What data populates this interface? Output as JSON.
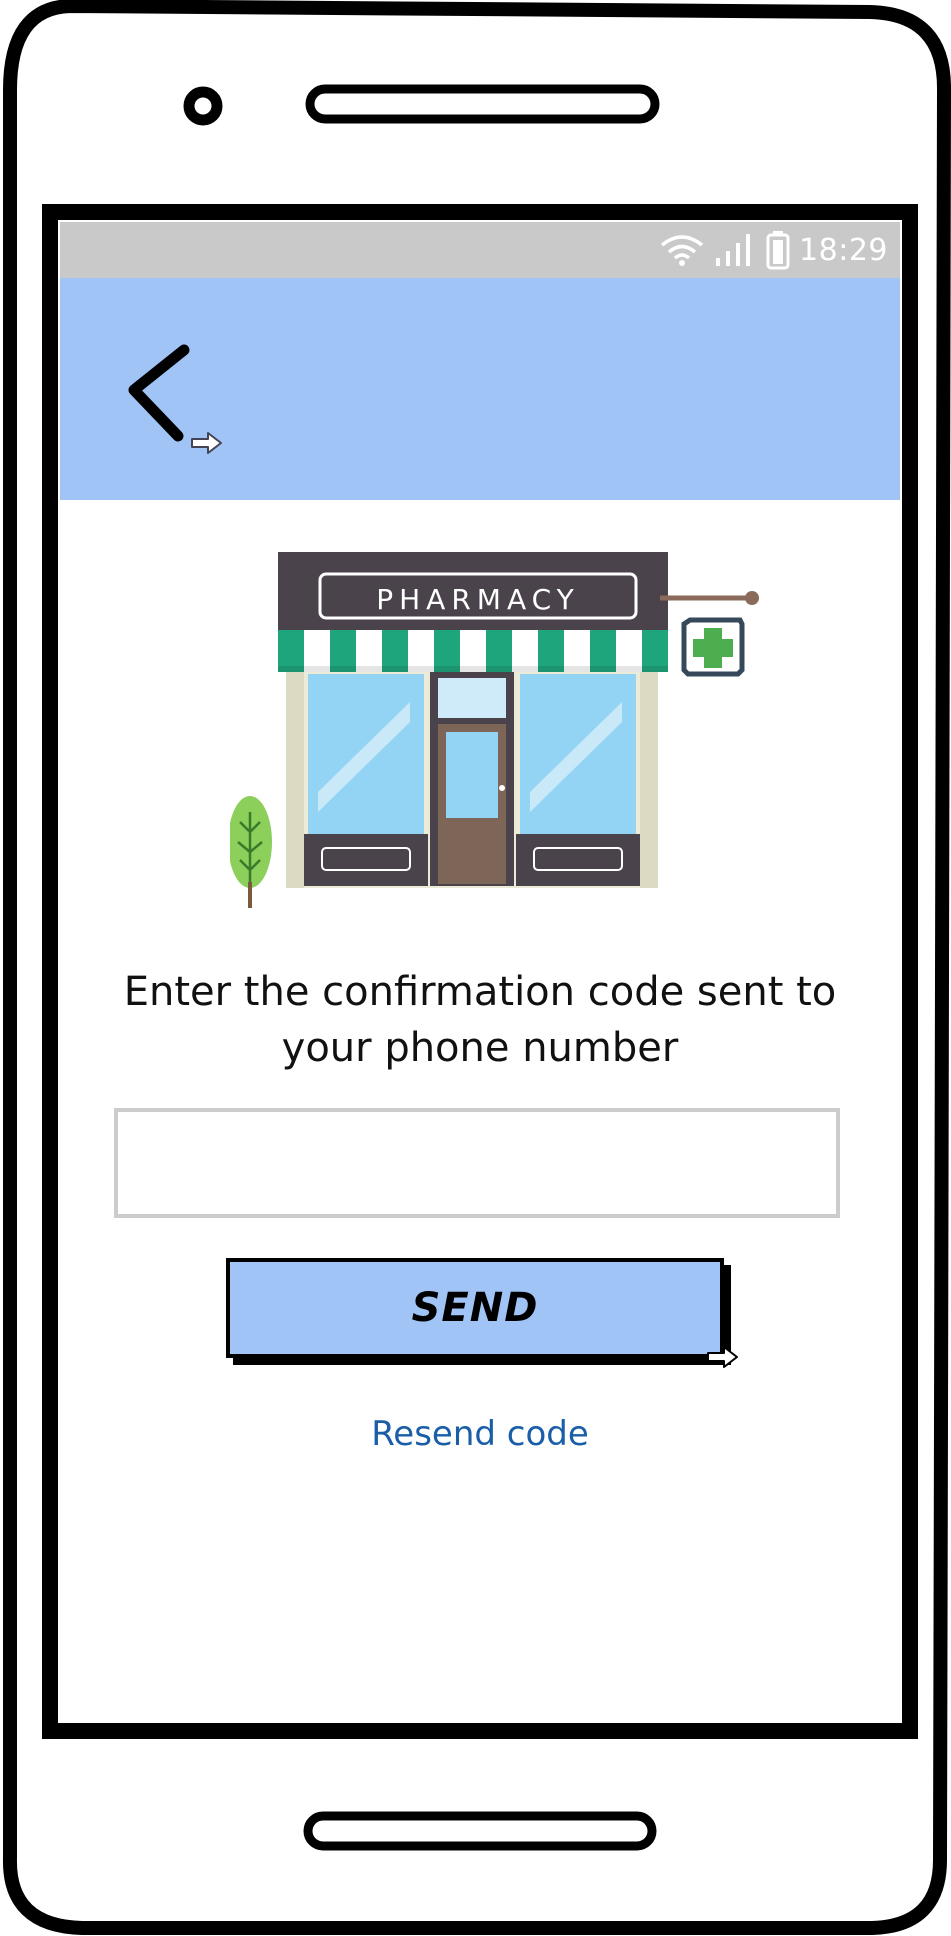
{
  "status_bar": {
    "time": "18:29",
    "icons": [
      "wifi-icon",
      "signal-icon",
      "battery-icon"
    ]
  },
  "app_bar": {
    "back_icon": "chevron-left-icon",
    "link_indicator_icon": "link-arrow-icon"
  },
  "illustration": {
    "sign_text": "PHARMACY",
    "icon": "pharmacy-cross-icon"
  },
  "confirmation": {
    "prompt_line1": "Enter the confirmation code sent to",
    "prompt_line2": "your phone number",
    "code_value": "",
    "send_label": "SEND",
    "resend_label": "Resend code"
  },
  "colors": {
    "accent": "#a0c4f5",
    "status_bar": "#c9c9c9",
    "link": "#1a5ea8",
    "awning_green": "#1fa57c"
  }
}
